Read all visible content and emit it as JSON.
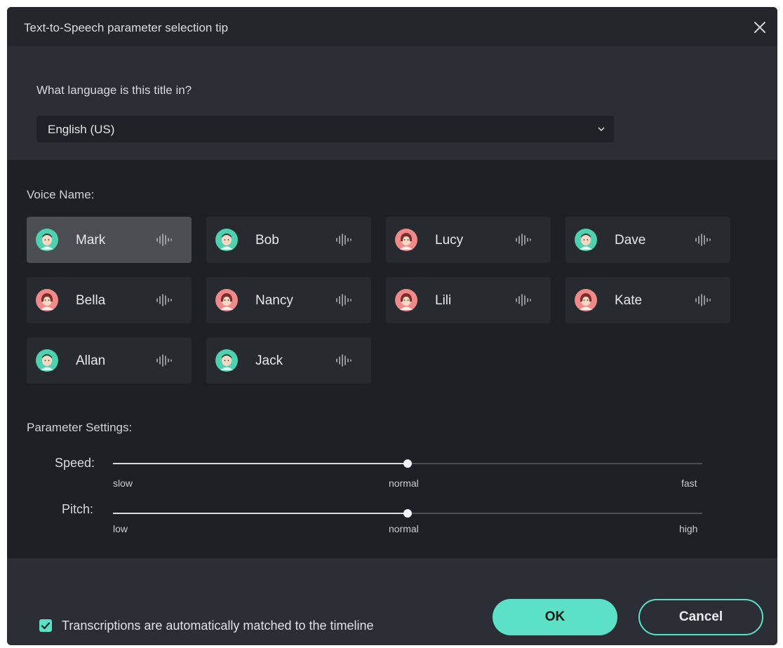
{
  "dialog": {
    "title": "Text-to-Speech parameter selection tip",
    "close_icon": "close-icon"
  },
  "language": {
    "question": "What language is this title in?",
    "selected": "English (US)"
  },
  "voices": {
    "label": "Voice Name:",
    "selected": "Mark",
    "items": [
      {
        "name": "Mark",
        "gender": "male"
      },
      {
        "name": "Bob",
        "gender": "male"
      },
      {
        "name": "Lucy",
        "gender": "female"
      },
      {
        "name": "Dave",
        "gender": "male"
      },
      {
        "name": "Bella",
        "gender": "female"
      },
      {
        "name": "Nancy",
        "gender": "female"
      },
      {
        "name": "Lili",
        "gender": "female"
      },
      {
        "name": "Kate",
        "gender": "female"
      },
      {
        "name": "Allan",
        "gender": "male"
      },
      {
        "name": "Jack",
        "gender": "male"
      }
    ]
  },
  "parameters": {
    "label": "Parameter Settings:",
    "speed": {
      "label": "Speed:",
      "min_label": "slow",
      "mid_label": "normal",
      "max_label": "fast",
      "value": 0.5
    },
    "pitch": {
      "label": "Pitch:",
      "min_label": "low",
      "mid_label": "normal",
      "max_label": "high",
      "value": 0.5
    }
  },
  "footer": {
    "auto_match_checked": true,
    "auto_match_label": "Transcriptions are automatically matched to the timeline",
    "ok_label": "OK",
    "cancel_label": "Cancel"
  },
  "colors": {
    "accent": "#5ce1c6",
    "male_avatar": "#4fd1b0",
    "female_avatar": "#f08a8a"
  }
}
